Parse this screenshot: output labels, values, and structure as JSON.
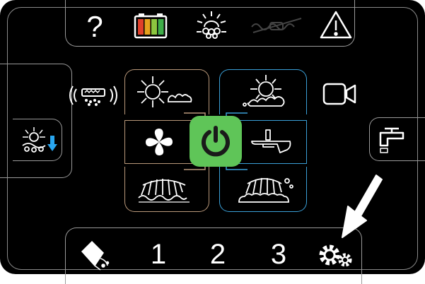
{
  "top_bar": {
    "help_icon": "question-mark",
    "battery_icon": "battery-level",
    "battery_colors": [
      "#e0402a",
      "#e6a21d",
      "#8cc63f",
      "#3fae49"
    ],
    "water_icon": "water-level",
    "disabled_icon": "pump-disabled",
    "warning_icon": "warning-triangle"
  },
  "side_left": {
    "radio_icon": "wireless-signal",
    "lower_brush_icon": "brush-down"
  },
  "side_right": {
    "camera_icon": "camera",
    "tap_icon": "water-tap"
  },
  "modes": {
    "left": [
      "brush-scrub",
      "fan",
      "brush-sweep"
    ],
    "right": [
      "brush-foam",
      "squeegee",
      "brush-bubbles"
    ],
    "power_color": "#5fc558"
  },
  "bottom_bar": {
    "preset_1": "1",
    "preset_2": "2",
    "preset_3": "3",
    "drain_icon": "drain",
    "settings_icon": "settings-gears"
  },
  "arrow_icon": "pointer-arrow"
}
